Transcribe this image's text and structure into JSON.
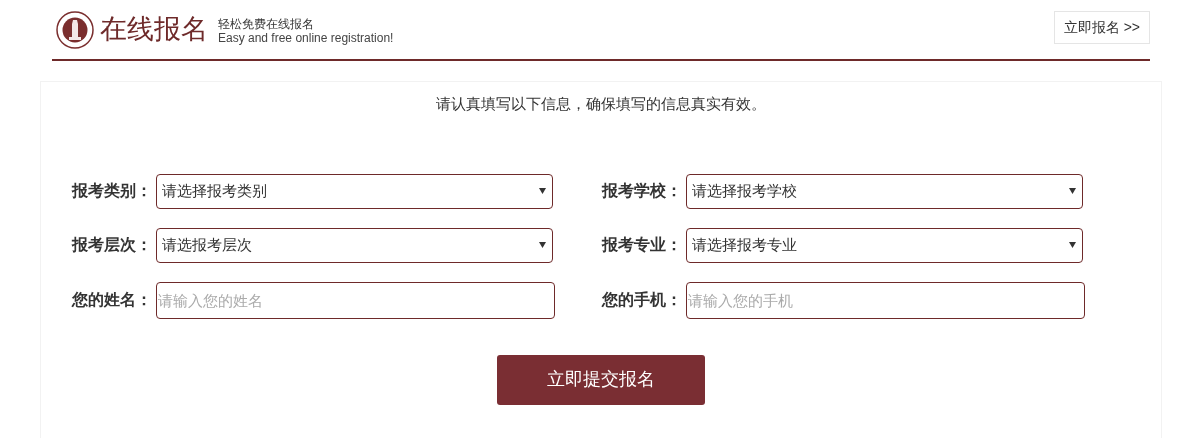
{
  "header": {
    "title": "在线报名",
    "subtitle": "轻松免费在线报名",
    "subtitle_en": "Easy and free online registration!",
    "register_link": "立即报名 >>"
  },
  "form": {
    "notice": "请认真填写以下信息，确保填写的信息真实有效。",
    "fields": [
      {
        "label": "报考类别：",
        "kind": "select",
        "value": "请选择报考类别"
      },
      {
        "label": "报考学校：",
        "kind": "select",
        "value": "请选择报考学校"
      },
      {
        "label": "报考层次：",
        "kind": "select",
        "value": "请选报考层次"
      },
      {
        "label": "报考专业：",
        "kind": "select",
        "value": "请选择报考专业"
      },
      {
        "label": "您的姓名：",
        "kind": "input",
        "placeholder": "请输入您的姓名"
      },
      {
        "label": "您的手机：",
        "kind": "input",
        "placeholder": "请输入您的手机"
      }
    ],
    "submit": "立即提交报名"
  }
}
